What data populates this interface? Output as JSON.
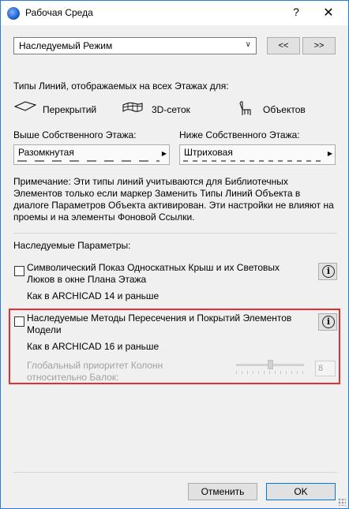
{
  "window": {
    "title": "Рабочая Среда",
    "help": "?",
    "close": "✕"
  },
  "mode_select": {
    "value": "Наследуемый Режим",
    "prev_label": "<<",
    "next_label": ">>"
  },
  "line_types": {
    "heading": "Типы Линий, отображаемых на всех Этажах для:",
    "categories": [
      "Перекрытий",
      "3D-сеток",
      "Объектов"
    ],
    "above_label": "Выше Собственного Этажа:",
    "above_value": "Разомкнутая",
    "below_label": "Ниже Собственного Этажа:",
    "below_value": "Штриховая"
  },
  "note": "Примечание: Эти типы линий учитываются для Библиотечных Элементов только если маркер Заменить Типы Линий Объекта в диалоге Параметров Объекта активирован. Эти настройки не влияют на проемы и на элементы Фоновой Ссылки.",
  "inherited": {
    "heading": "Наследуемые Параметры:",
    "option1_label": "Символический Показ Односкатных Крыш и их Световых Люков в окне Плана Этажа",
    "option1_sub": "Как в ARCHICAD 14 и раньше",
    "option2_label": "Наследуемые Методы Пересечения и Покрытий Элементов Модели",
    "option2_sub": "Как в ARCHICAD 16 и раньше",
    "priority_label": "Глобальный приоритет Колонн относительно Балок:",
    "priority_value": "8",
    "info_glyph": "i"
  },
  "footer": {
    "cancel_label": "Отменить",
    "ok_label": "OK"
  },
  "colors": {
    "highlight": "#e03030",
    "window_border": "#2b79d9"
  }
}
